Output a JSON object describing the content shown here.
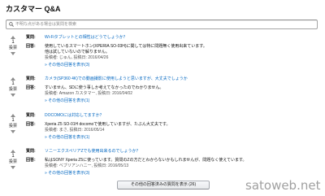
{
  "page": {
    "title": "カスタマー Q&A",
    "watermark": "satoweb.net"
  },
  "search": {
    "placeholder": "不明な点がある場合は質問を検索",
    "icon": "search-icon"
  },
  "icons": {
    "vote_up": "vote-up-icon",
    "vote_down": "vote-down-icon"
  },
  "colors": {
    "text": "#111111",
    "link": "#0066c0",
    "meta": "#555555",
    "vote_arrow": "#8d8d8d"
  },
  "labels": {
    "question": "質問:",
    "answer": "回答:",
    "votes": "投票"
  },
  "questions": [
    {
      "votes": "1",
      "question": "Wi-Fiタブレットとの相性はどうでしょうか？",
      "answer_lines": [
        "使用しているスマートホン(XPERIA SO-03H)に関しては特に問題無く使用出来ています。",
        "他は試していないので解りません。"
      ],
      "meta": "投稿者: じゅん, 投稿日: 2016/04/26",
      "more": "» その他の回答を表示(3)"
    },
    {
      "votes": "1",
      "question": "カメラ(SP360 4K)での動画撮影に使用しようと思いますが、大丈夫でしょうか",
      "answer_lines": [
        "すいません、SDに使う事しか考えてなかったのでわかりません。"
      ],
      "meta": "投稿者: Amazon カスタマー, 投稿日: 2016/04/02",
      "more": "» その他の回答を表示(1)"
    },
    {
      "votes": "1",
      "question": "DOCOMOには対応してますか？",
      "answer_lines": [
        "Xperia Z5 SO-01H docomoで使用していますが、たぶん大丈夫です。"
      ],
      "meta": "投稿者: まさ, 投稿日: 2016/05/14",
      "more": "» その他の回答を表示(1)"
    },
    {
      "votes": "1",
      "question": "ソニーエクスペリアZでも使用出来るのでしょうか？",
      "answer_lines": [
        "私はSONY Xperia Z5に使っています。質問のZの方だとわからないかもしれませんが、問題なく使えています。"
      ],
      "meta": "投稿者: ベブリアンハニー, 投稿日: 2016/05/13",
      "more": "» その他の回答を表示(3)"
    }
  ],
  "footer": {
    "more_questions": "その他の回答済みの質問を表示 (26)"
  }
}
